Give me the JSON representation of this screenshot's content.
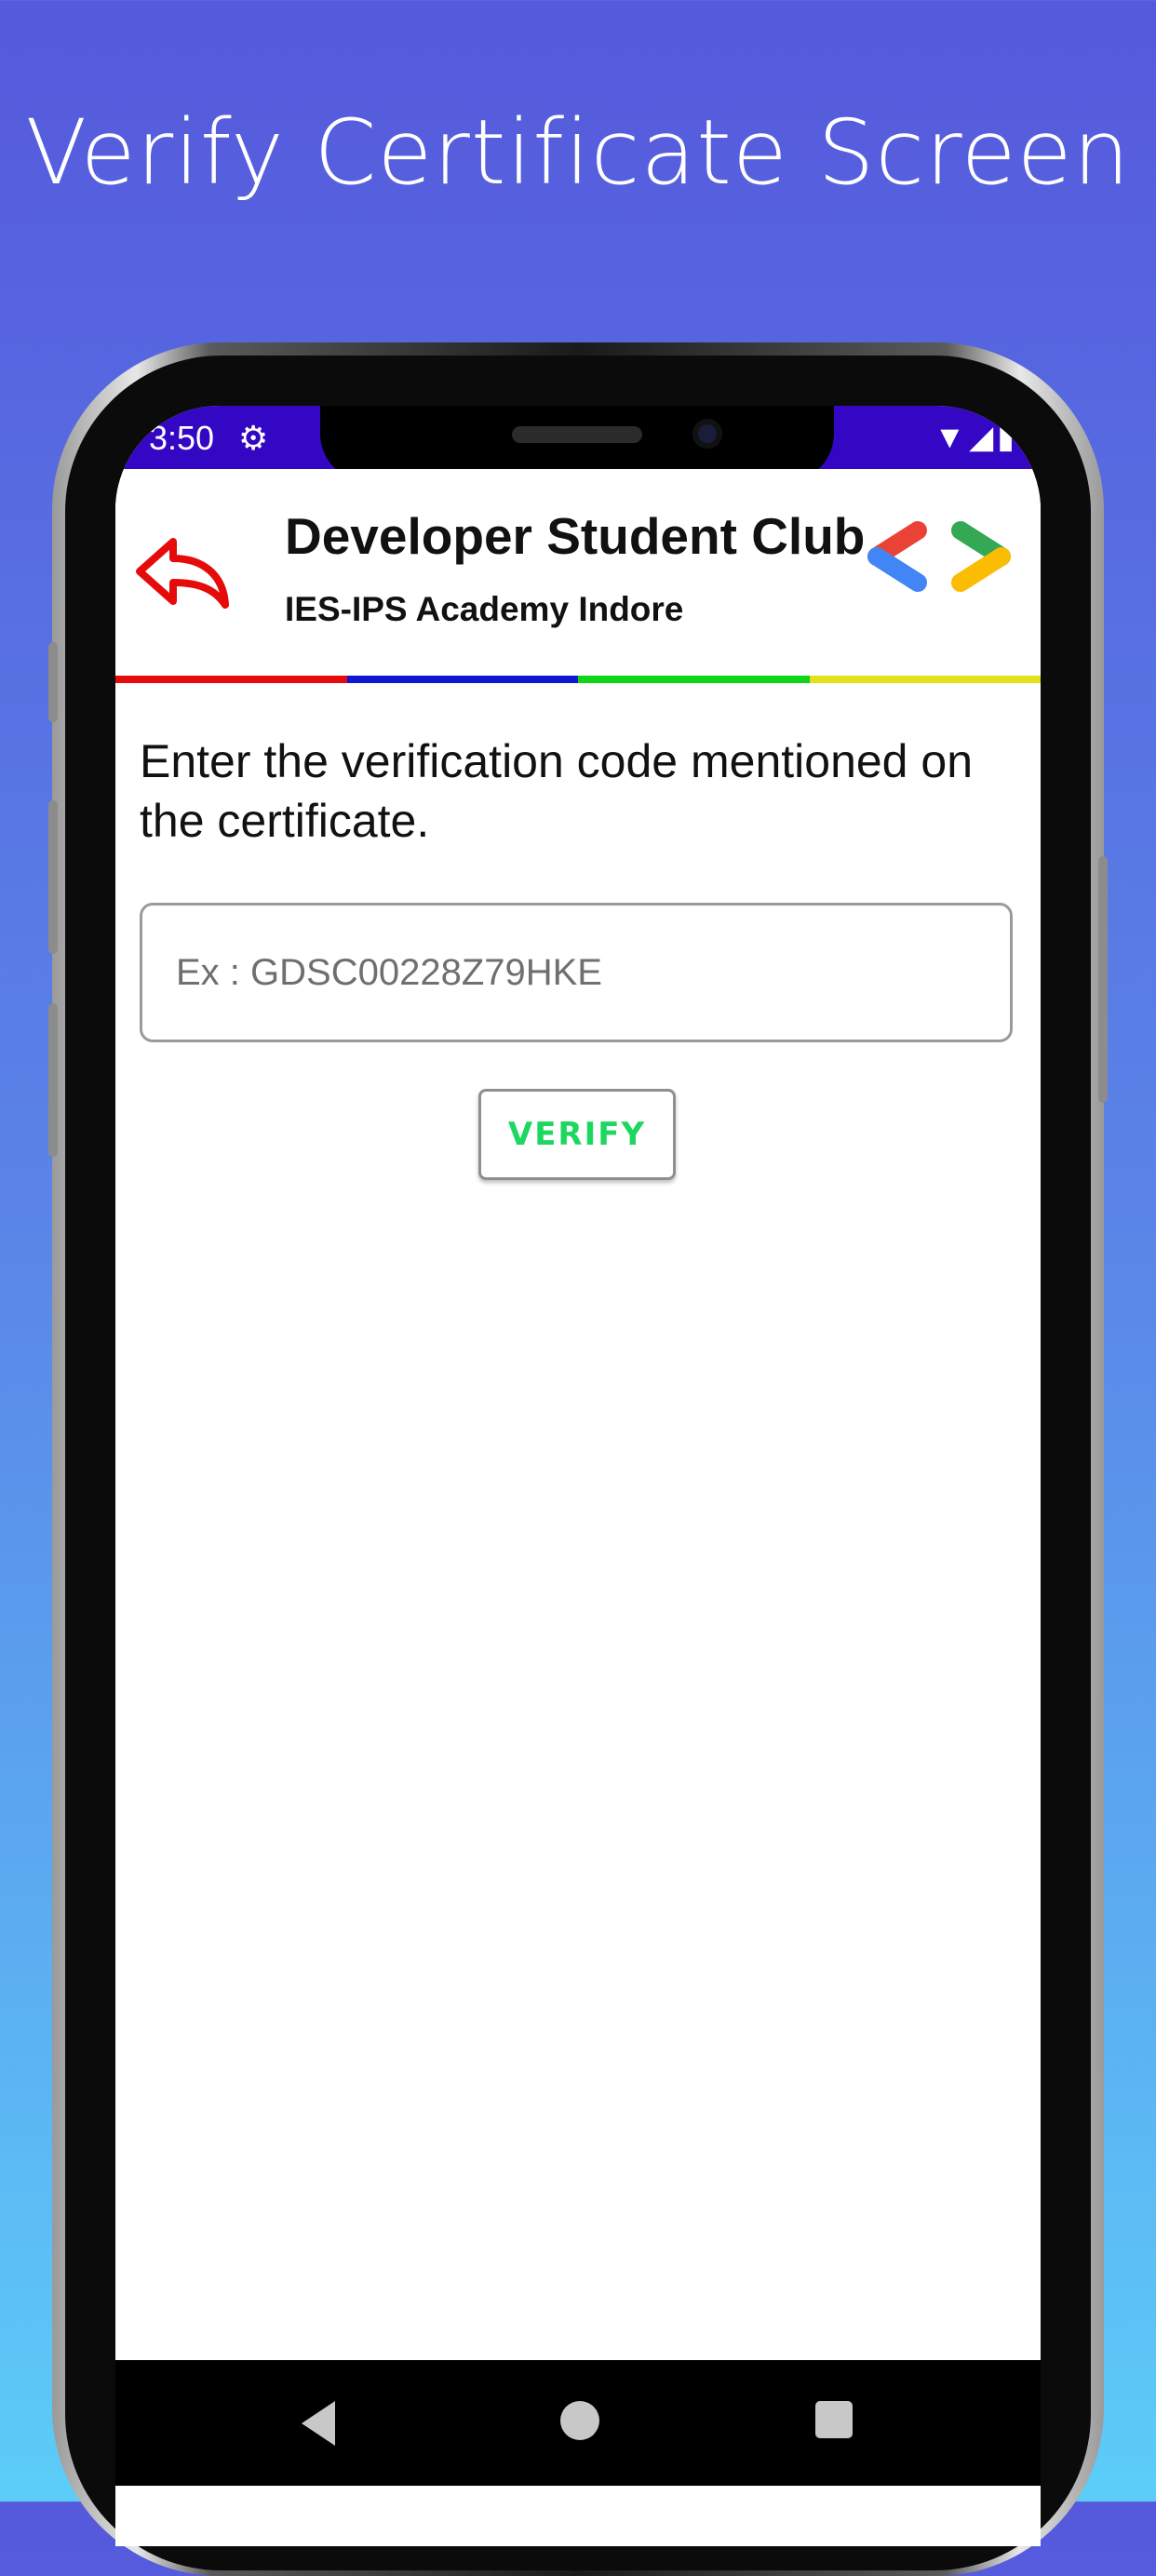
{
  "promo": {
    "title": "Verify Certificate Screen"
  },
  "status_bar": {
    "time": "3:50",
    "settings_icon": "gear-icon",
    "right_icons": [
      "wifi-icon",
      "signal-icon",
      "battery-icon"
    ]
  },
  "app_bar": {
    "title": "Developer Student Club",
    "subtitle": "IES-IPS Academy Indore",
    "back_icon": "back-arrow-icon",
    "logo_icon": "gdsc-logo-icon",
    "stripe_colors": [
      "#e60b0b",
      "#1017d0",
      "#0ed41a",
      "#e3e21a"
    ]
  },
  "verify": {
    "instruction": "Enter the verification code mentioned on the certificate.",
    "input_placeholder": "Ex : GDSC00228Z79HKE",
    "input_value": "",
    "button_label": "VERIFY"
  },
  "nav_bar": {
    "icons": [
      "nav-back-icon",
      "nav-home-icon",
      "nav-recents-icon"
    ]
  },
  "colors": {
    "status_bar": "#3407c5",
    "accent_green": "#1ed760",
    "back_icon": "#e60b0b"
  }
}
